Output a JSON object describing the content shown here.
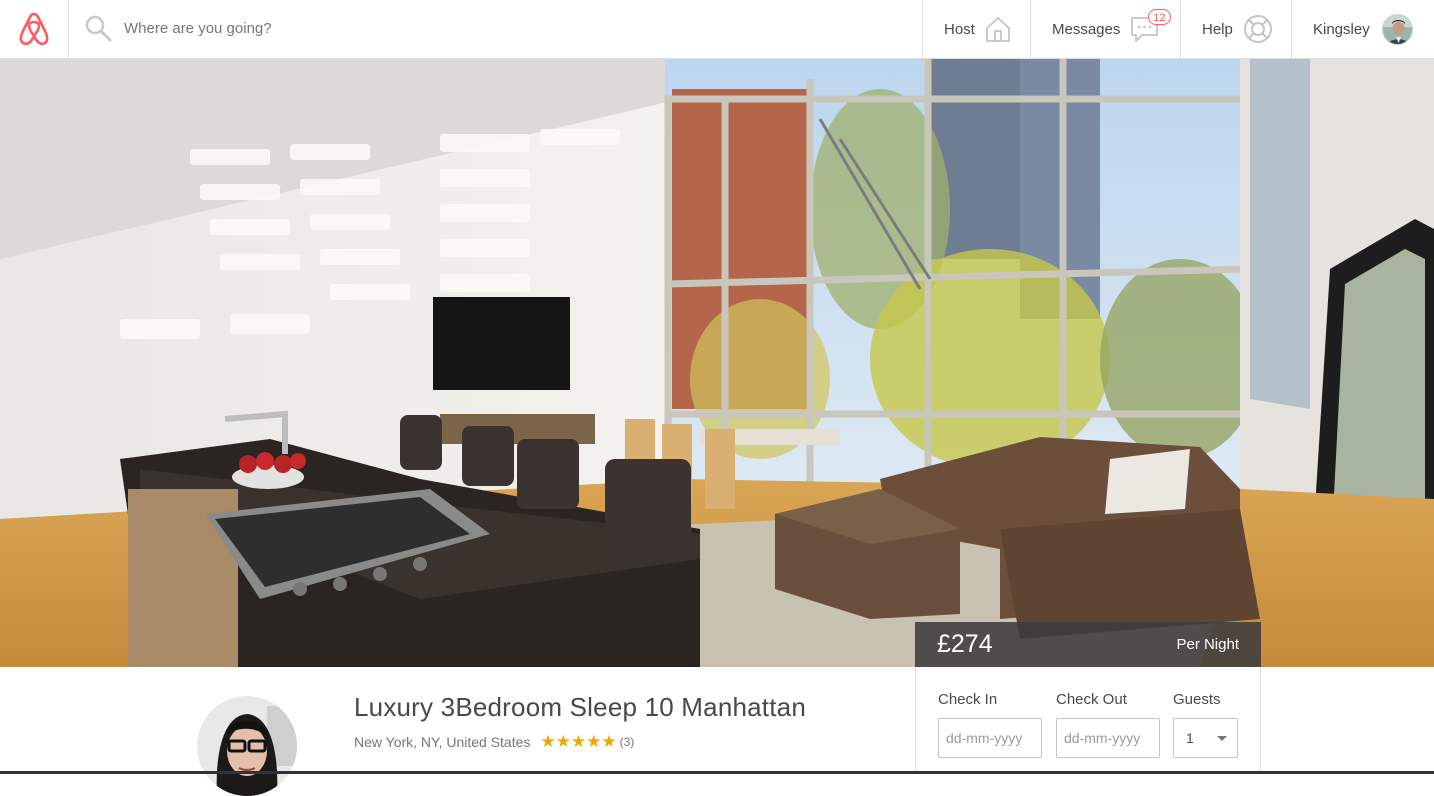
{
  "header": {
    "search_placeholder": "Where are you going?",
    "nav": {
      "host_label": "Host",
      "messages_label": "Messages",
      "messages_count": "12",
      "help_label": "Help",
      "user_name": "Kingsley"
    }
  },
  "listing": {
    "price": "£274",
    "price_unit": "Per Night",
    "title": "Luxury 3Bedroom Sleep 10 Manhattan",
    "location": "New York, NY, United States",
    "stars": "★★★★★",
    "reviews": "(3)"
  },
  "booking": {
    "checkin_label": "Check In",
    "checkin_placeholder": "dd-mm-yyyy",
    "checkout_label": "Check Out",
    "checkout_placeholder": "dd-mm-yyyy",
    "guests_label": "Guests",
    "guests_value": "1"
  },
  "colors": {
    "brand": "#ff5a5f",
    "star": "#f0a500",
    "text": "#484848"
  },
  "icons": [
    "airbnb-logo",
    "search-icon",
    "house-icon",
    "chat-icon",
    "lifebuoy-icon",
    "user-avatar",
    "chevron-down-icon"
  ]
}
